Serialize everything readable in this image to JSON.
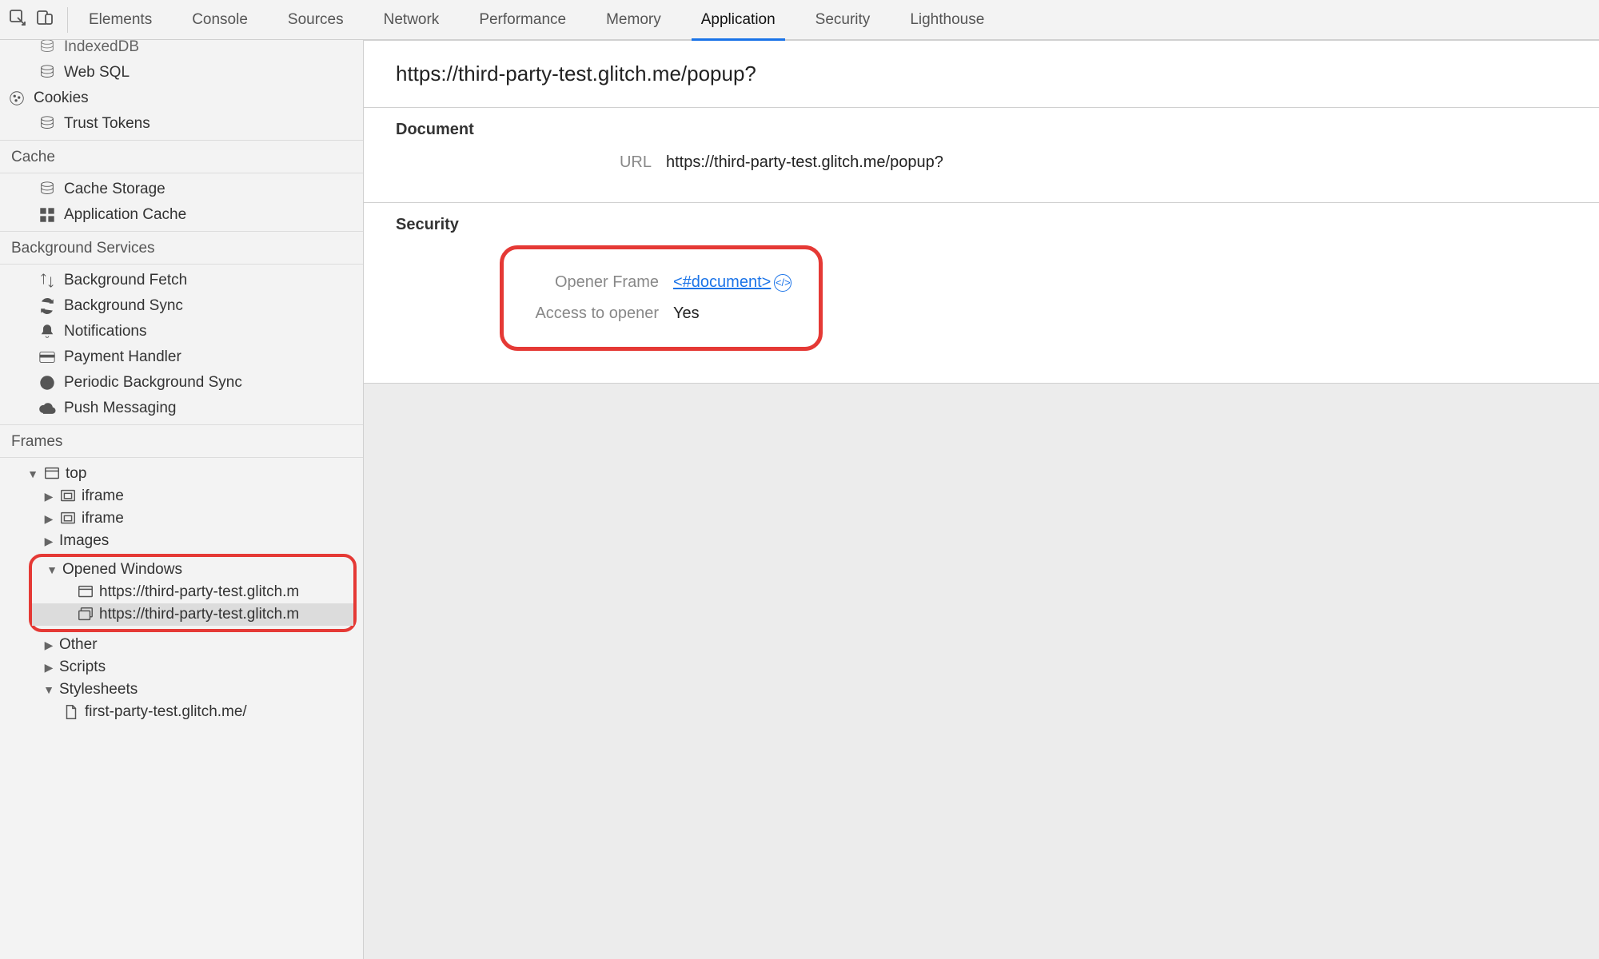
{
  "tabs": {
    "elements": "Elements",
    "console": "Console",
    "sources": "Sources",
    "network": "Network",
    "performance": "Performance",
    "memory": "Memory",
    "application": "Application",
    "security": "Security",
    "lighthouse": "Lighthouse"
  },
  "sidebar": {
    "storage": {
      "indexeddb": "IndexedDB",
      "websql": "Web SQL",
      "cookies": "Cookies",
      "trusttokens": "Trust Tokens"
    },
    "cache_title": "Cache",
    "cache": {
      "cachestorage": "Cache Storage",
      "appcache": "Application Cache"
    },
    "bg_title": "Background Services",
    "bg": {
      "bgfetch": "Background Fetch",
      "bgsync": "Background Sync",
      "notifications": "Notifications",
      "paymenthandler": "Payment Handler",
      "periodic": "Periodic Background Sync",
      "push": "Push Messaging"
    },
    "frames_title": "Frames",
    "frames": {
      "top": "top",
      "iframe": "iframe",
      "images": "Images",
      "opened": "Opened Windows",
      "win1": "https://third-party-test.glitch.m",
      "win2": "https://third-party-test.glitch.m",
      "other": "Other",
      "scripts": "Scripts",
      "stylesheets": "Stylesheets",
      "leaf": "first-party-test.glitch.me/"
    }
  },
  "main": {
    "title": "https://third-party-test.glitch.me/popup?",
    "document_heading": "Document",
    "url_label": "URL",
    "url_value": "https://third-party-test.glitch.me/popup?",
    "security_heading": "Security",
    "opener_label": "Opener Frame",
    "opener_value": "<#document>",
    "access_label": "Access to opener",
    "access_value": "Yes"
  }
}
